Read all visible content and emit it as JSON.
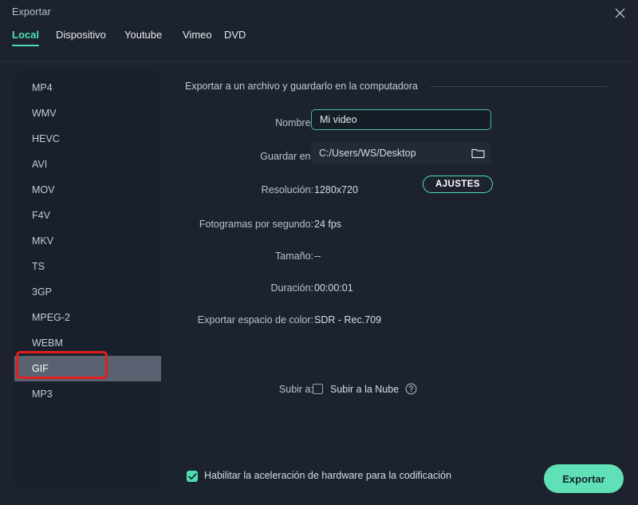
{
  "window": {
    "title": "Exportar",
    "close_icon": "close-icon"
  },
  "tabs": [
    {
      "label": "Local",
      "active": true
    },
    {
      "label": "Dispositivo",
      "active": false
    },
    {
      "label": "Youtube",
      "active": false
    },
    {
      "label": "Vimeo",
      "active": false
    },
    {
      "label": "DVD",
      "active": false
    }
  ],
  "sidebar": {
    "formats": [
      {
        "label": "MP4",
        "selected": false
      },
      {
        "label": "WMV",
        "selected": false
      },
      {
        "label": "HEVC",
        "selected": false
      },
      {
        "label": "AVI",
        "selected": false
      },
      {
        "label": "MOV",
        "selected": false
      },
      {
        "label": "F4V",
        "selected": false
      },
      {
        "label": "MKV",
        "selected": false
      },
      {
        "label": "TS",
        "selected": false
      },
      {
        "label": "3GP",
        "selected": false
      },
      {
        "label": "MPEG-2",
        "selected": false
      },
      {
        "label": "WEBM",
        "selected": false
      },
      {
        "label": "GIF",
        "selected": true
      },
      {
        "label": "MP3",
        "selected": false
      }
    ]
  },
  "main": {
    "section_header": "Exportar a un archivo y guardarlo en la computadora",
    "fields": {
      "name_label": "Nombre:",
      "name_value": "Mi video",
      "name_placeholder": "Mi video",
      "path_label": "Guardar en:",
      "path_value": "C:/Users/WS/Desktop",
      "folder_icon": "folder-icon",
      "resolution_label": "Resolución:",
      "resolution_value": "1280x720",
      "settings_button": "AJUSTES",
      "fps_label": "Fotogramas por segundo:",
      "fps_value": "24 fps",
      "size_label": "Tamaño:",
      "size_value": "--",
      "duration_label": "Duración:",
      "duration_value": "00:00:01",
      "colorspace_label": "Exportar espacio de color:",
      "colorspace_value": "SDR - Rec.709"
    },
    "upload": {
      "label": "Subir a:",
      "checkbox_label": "Subir a la Nube",
      "checked": false,
      "help_icon": "help-circle-icon"
    }
  },
  "bottom": {
    "hw_accel_label": "Habilitar la aceleración de hardware para la codificación",
    "hw_accel_checked": true,
    "export_label": "Exportar"
  },
  "annotation": {
    "type": "red-highlight-box",
    "target": "GIF"
  },
  "colors": {
    "accent": "#4ddfb4",
    "export_button": "#5fe0b6",
    "window_bg": "#1d232e",
    "sidebar_bg": "#1a202b",
    "selected_row": "#5a6170",
    "annotation_red": "#e02020"
  }
}
